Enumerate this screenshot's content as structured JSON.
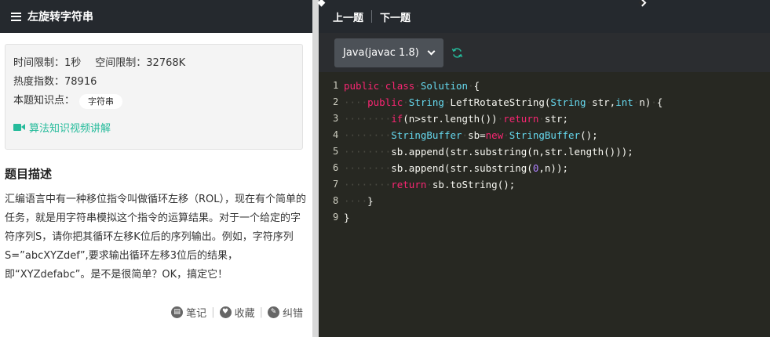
{
  "left": {
    "title": "左旋转字符串",
    "time_limit": "时间限制：1秒",
    "space_limit": "空间限制：32768K",
    "heat": "热度指数：78916",
    "knowledge_label": "本题知识点：",
    "knowledge_tag": "字符串",
    "video_link": "算法知识视频讲解",
    "desc_title": "题目描述",
    "desc_text": "汇编语言中有一种移位指令叫做循环左移（ROL），现在有个简单的任务，就是用字符串模拟这个指令的运算结果。对于一个给定的字符序列S，请你把其循环左移K位后的序列输出。例如，字符序列S=”abcXYZdef”,要求输出循环左移3位后的结果，即“XYZdefabc”。是不是很简单？OK，搞定它！",
    "footer": {
      "note": "笔记",
      "fav": "收藏",
      "report": "纠错"
    }
  },
  "right": {
    "prev": "上一题",
    "next": "下一题",
    "language": "Java(javac 1.8)"
  },
  "code": {
    "line_numbers": [
      "1",
      "2",
      "3",
      "4",
      "5",
      "6",
      "7",
      "8",
      "9"
    ],
    "lines": [
      "public class Solution {",
      "    public String LeftRotateString(String str,int n) {",
      "        if(n>str.length()) return str;",
      "        StringBuffer sb=new StringBuffer();",
      "        sb.append(str.substring(n,str.length()));",
      "        sb.append(str.substring(0,n));",
      "        return sb.toString();",
      "    }",
      "}"
    ]
  },
  "icons": {
    "menu": "menu-icon",
    "video": "video-camera-icon",
    "refresh": "refresh-icon",
    "note": "note-icon",
    "fav": "heart-icon",
    "report": "pencil-icon"
  },
  "colors": {
    "header_bg": "#25292e",
    "accent_green": "#25bb9b",
    "editor_bg": "#272822",
    "keyword": "#f92672",
    "type": "#66d9ef",
    "number": "#ae81ff"
  }
}
